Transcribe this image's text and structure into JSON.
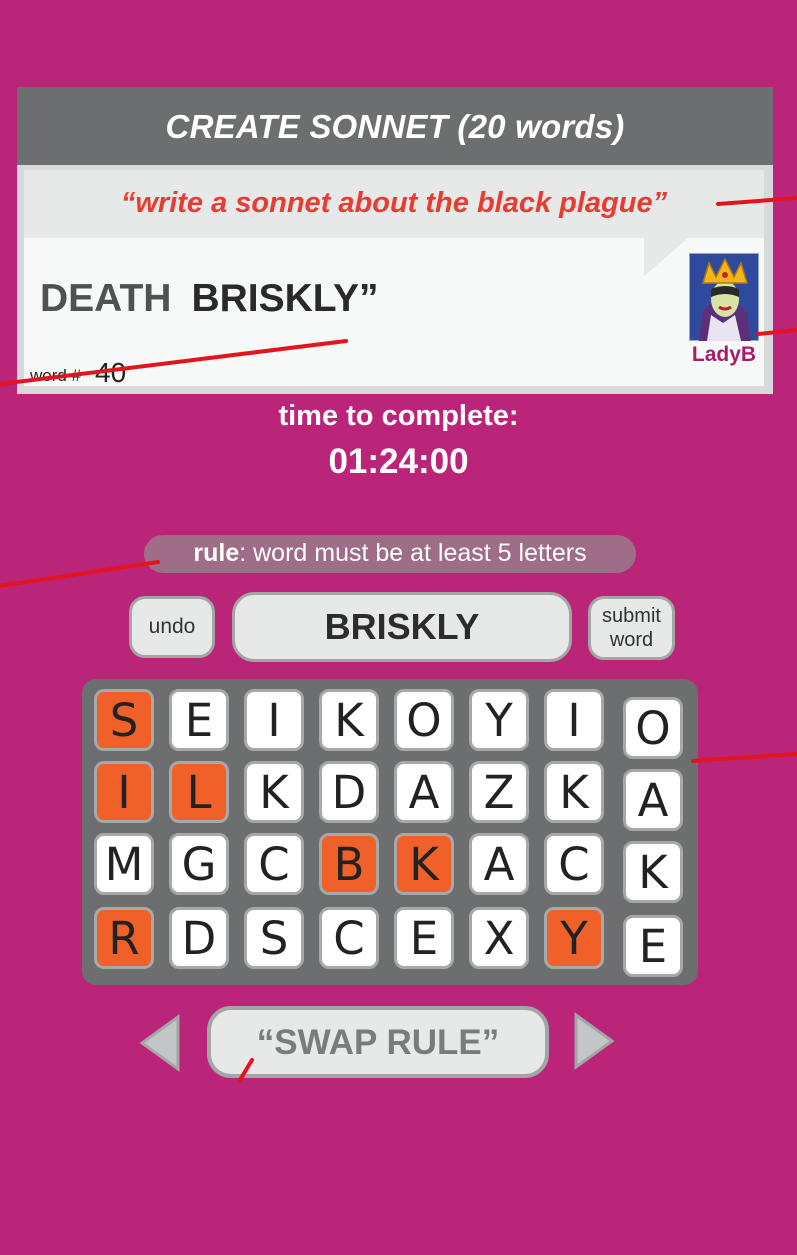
{
  "header": {
    "title": "CREATE SONNET (20 words)"
  },
  "prompt": {
    "text": "“write a sonnet about the black plague”"
  },
  "sonnet": {
    "words": [
      "DEATH",
      "BRISKLY”"
    ],
    "word_label": "word #",
    "word_number": "40"
  },
  "user": {
    "name": "LadyB",
    "avatar_icon": "evil-queen-avatar"
  },
  "timer": {
    "label": "time to complete:",
    "value": "01:24:00"
  },
  "rule": {
    "prefix": "rule",
    "text": ": word must be at least 5 letters"
  },
  "controls": {
    "undo_label": "undo",
    "current_word": "BRISKLY",
    "submit_line1": "submit",
    "submit_line2": "word"
  },
  "grid": {
    "rows": [
      [
        {
          "l": "S",
          "sel": true
        },
        {
          "l": "E"
        },
        {
          "l": "I"
        },
        {
          "l": "K"
        },
        {
          "l": "O"
        },
        {
          "l": "Y"
        },
        {
          "l": "I"
        },
        {
          "l": "O"
        }
      ],
      [
        {
          "l": "I",
          "sel": true
        },
        {
          "l": "L",
          "sel": true
        },
        {
          "l": "K"
        },
        {
          "l": "D"
        },
        {
          "l": "A"
        },
        {
          "l": "Z"
        },
        {
          "l": "K"
        },
        {
          "l": "A"
        }
      ],
      [
        {
          "l": "M"
        },
        {
          "l": "G"
        },
        {
          "l": "C"
        },
        {
          "l": "B",
          "sel": true
        },
        {
          "l": "K",
          "sel": true
        },
        {
          "l": "A"
        },
        {
          "l": "C"
        },
        {
          "l": "K"
        }
      ],
      [
        {
          "l": "R",
          "sel": true
        },
        {
          "l": "D"
        },
        {
          "l": "S"
        },
        {
          "l": "C"
        },
        {
          "l": "E"
        },
        {
          "l": "X"
        },
        {
          "l": "Y",
          "sel": true
        },
        {
          "l": "E"
        }
      ]
    ]
  },
  "swap": {
    "label": "“SWAP RULE”",
    "prev_icon": "arrow-left-icon",
    "next_icon": "arrow-right-icon"
  },
  "colors": {
    "background": "#bb2579",
    "accent": "#ef6128",
    "prompt": "#e63c32"
  }
}
